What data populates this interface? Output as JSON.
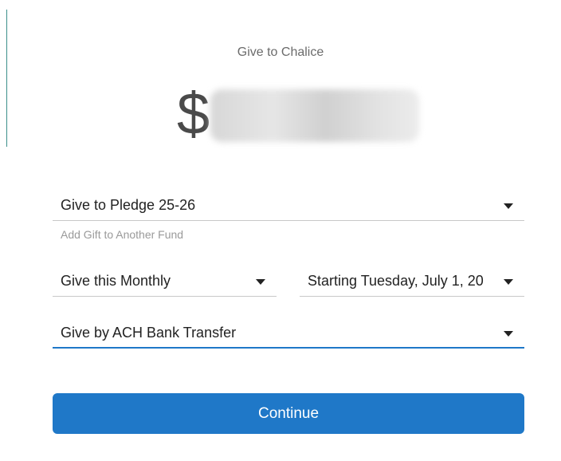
{
  "title": "Give to Chalice",
  "amount": {
    "currency_symbol": "$",
    "value_redacted": true
  },
  "fund_select": {
    "label": "Give to Pledge 25-26",
    "icon": "caret-down-icon"
  },
  "add_fund_link": "Add Gift to Another Fund",
  "frequency_select": {
    "label": "Give this Monthly",
    "icon": "caret-down-icon"
  },
  "start_date_select": {
    "label": "Starting Tuesday, July 1, 20",
    "icon": "caret-down-icon"
  },
  "payment_method_select": {
    "label": "Give by ACH Bank Transfer",
    "icon": "caret-down-icon",
    "focused": true
  },
  "continue_button": {
    "label": "Continue"
  },
  "colors": {
    "accent": "#1f78c8",
    "text": "#222222",
    "muted": "#9a9a9a",
    "title": "#6b6b6b",
    "divider": "#c8c8c8",
    "left_edge": "#3b8f8a"
  }
}
